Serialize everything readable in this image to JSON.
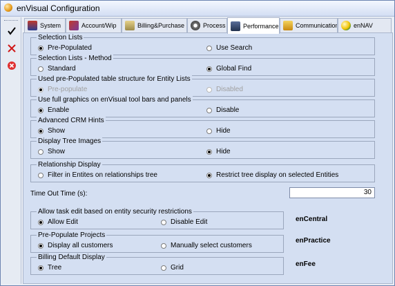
{
  "window": {
    "title": "enVisual Configuration"
  },
  "side_toolbar": {
    "icons": [
      "check-icon",
      "close-icon",
      "cancel-circle-icon"
    ]
  },
  "tabs": [
    {
      "label": "System",
      "icon": "system-icon"
    },
    {
      "label": "Account/Wip",
      "icon": "account-icon"
    },
    {
      "label": "Billing&Purchase",
      "icon": "billing-icon"
    },
    {
      "label": "Process",
      "icon": "process-icon"
    },
    {
      "label": "Performance",
      "icon": "performance-icon",
      "active": true
    },
    {
      "label": "Communications",
      "icon": "communications-icon"
    },
    {
      "label": "enNAV",
      "icon": "ennav-icon"
    }
  ],
  "groups": [
    {
      "legend": "Selection Lists",
      "left": {
        "label": "Pre-Populated",
        "selected": true
      },
      "right": {
        "label": "Use Search",
        "selected": false
      }
    },
    {
      "legend": "Selection Lists - Method",
      "left": {
        "label": "Standard",
        "selected": false
      },
      "right": {
        "label": "Global Find",
        "selected": true
      }
    },
    {
      "legend": "Used pre-Populated table structure for Entity Lists",
      "disabled": true,
      "left": {
        "label": "Pre-populate",
        "selected": true
      },
      "right": {
        "label": "Disabled",
        "selected": false
      }
    },
    {
      "legend": "Use full graphics on enVisual tool bars and panels",
      "left": {
        "label": "Enable",
        "selected": true
      },
      "right": {
        "label": "Disable",
        "selected": false
      }
    },
    {
      "legend": "Advanced CRM Hints",
      "left": {
        "label": "Show",
        "selected": true
      },
      "right": {
        "label": "Hide",
        "selected": false
      }
    },
    {
      "legend": "Display Tree Images",
      "left": {
        "label": "Show",
        "selected": false
      },
      "right": {
        "label": "Hide",
        "selected": true
      }
    },
    {
      "legend": "Relationship Display",
      "left": {
        "label": "Filter in Entites on relationships tree",
        "selected": false
      },
      "right": {
        "label": "Restrict tree display on selected Entities",
        "selected": true
      }
    }
  ],
  "timeout": {
    "label": "Time Out Time (s):",
    "value": "30"
  },
  "lower_groups": [
    {
      "legend": "Allow task edit based on entity security restrictions",
      "left": {
        "label": "Allow Edit",
        "selected": true
      },
      "right": {
        "label": "Disable Edit",
        "selected": false
      },
      "brand": "enCentral"
    },
    {
      "legend": "Pre-Populate Projects",
      "left": {
        "label": "Display all customers",
        "selected": true
      },
      "right": {
        "label": "Manually select customers",
        "selected": false
      },
      "brand": "enPractice"
    },
    {
      "legend": "Billing Default Display",
      "left": {
        "label": "Tree",
        "selected": true
      },
      "right": {
        "label": "Grid",
        "selected": false
      },
      "brand": "enFee"
    }
  ],
  "colors": {
    "panel": "#d4dff2",
    "window": "#eaeef5",
    "border": "#9aa6bc"
  }
}
